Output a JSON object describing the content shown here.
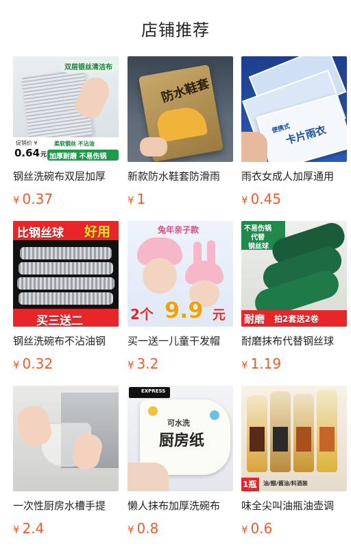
{
  "header": {
    "title": "店铺推荐"
  },
  "products": [
    {
      "title": "钢丝洗碗布双层加厚",
      "price_symbol": "¥",
      "price": "0.37",
      "image_texts": {
        "banner": "双层银丝清洁布",
        "badge_label": "促销价 ¥",
        "badge_value": "0.64",
        "badge_unit": "元",
        "tag1": "柔软钢丝 不沾油",
        "tag2": "加厚耐磨 不易伤锅"
      }
    },
    {
      "title": "新款防水鞋套防滑雨",
      "price_symbol": "¥",
      "price": "1",
      "image_texts": {
        "main": "防水鞋套"
      }
    },
    {
      "title": "雨衣女成人加厚通用",
      "price_symbol": "¥",
      "price": "0.45",
      "image_texts": {
        "pack": "卡片雨衣",
        "small": "便携式"
      }
    },
    {
      "title": "钢丝洗碗布不沾油钢",
      "price_symbol": "¥",
      "price": "0.32",
      "image_texts": {
        "top": "比钢丝球",
        "top_highlight": "好用",
        "bottom": "买三送二"
      }
    },
    {
      "title": "买一送一儿童干发帽",
      "price_symbol": "¥",
      "price": "3.2",
      "image_texts": {
        "top": "兔年亲子款",
        "prefix": "2个",
        "price": "9.9",
        "suffix": "元"
      }
    },
    {
      "title": "耐磨抹布代替钢丝球",
      "price_symbol": "¥",
      "price": "1.19",
      "image_texts": {
        "top1": "不易伤锅",
        "top2": "代替",
        "top3": "钢丝球",
        "bottom_left": "耐磨",
        "bottom_right": "拍2套送2卷"
      }
    },
    {
      "title": "一次性厨房水槽手提",
      "price_symbol": "¥",
      "price": "2.4",
      "image_texts": {}
    },
    {
      "title": "懒人抹布加厚洗碗布",
      "price_symbol": "¥",
      "price": "0.8",
      "image_texts": {
        "main": "厨房纸",
        "top": "可水洗",
        "badge": "EXPRESS"
      }
    },
    {
      "title": "味全尖叫油瓶油壶调",
      "price_symbol": "¥",
      "price": "0.6",
      "image_texts": {
        "bottom_left": "1瓶",
        "bottom_right": "油/醋/酱油/料酒装"
      }
    }
  ],
  "colors": {
    "accent": "#ef5a2a"
  },
  "icons": {
    "express_logo": "sf-express-logo"
  }
}
